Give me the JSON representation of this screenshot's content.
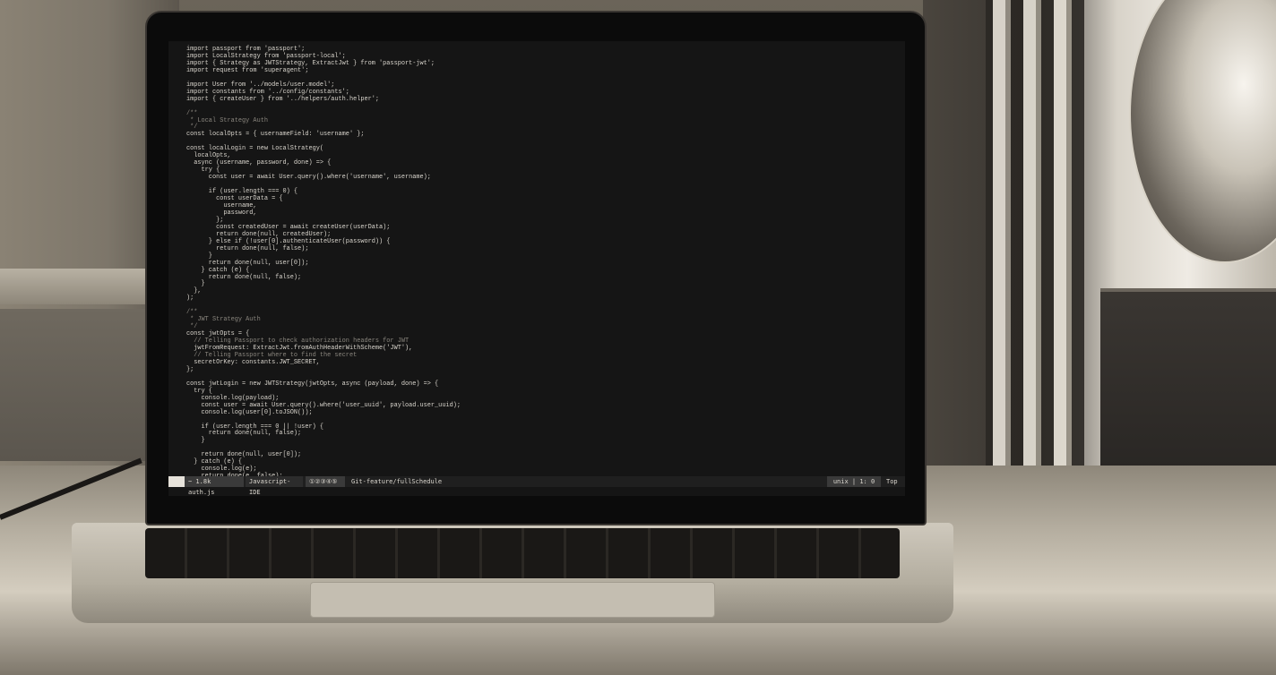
{
  "editor": {
    "code_lines": [
      "import passport from 'passport';",
      "import LocalStrategy from 'passport-local';",
      "import { Strategy as JWTStrategy, ExtractJwt } from 'passport-jwt';",
      "import request from 'superagent';",
      "",
      "import User from '../models/user.model';",
      "import constants from '../config/constants';",
      "import { createUser } from '../helpers/auth.helper';",
      "",
      "/**",
      " * Local Strategy Auth",
      " */",
      "const localOpts = { usernameField: 'username' };",
      "",
      "const localLogin = new LocalStrategy(",
      "  localOpts,",
      "  async (username, password, done) => {",
      "    try {",
      "      const user = await User.query().where('username', username);",
      "",
      "      if (user.length === 0) {",
      "        const userData = {",
      "          username,",
      "          password,",
      "        };",
      "        const createdUser = await createUser(userData);",
      "        return done(null, createdUser);",
      "      } else if (!user[0].authenticateUser(password)) {",
      "        return done(null, false);",
      "      }",
      "      return done(null, user[0]);",
      "    } catch (e) {",
      "      return done(null, false);",
      "    }",
      "  },",
      ");",
      "",
      "/**",
      " * JWT Strategy Auth",
      " */",
      "const jwtOpts = {",
      "  // Telling Passport to check authorization headers for JWT",
      "  jwtFromRequest: ExtractJwt.fromAuthHeaderWithScheme('JWT'),",
      "  // Telling Passport where to find the secret",
      "  secretOrKey: constants.JWT_SECRET,",
      "};",
      "",
      "const jwtLogin = new JWTStrategy(jwtOpts, async (payload, done) => {",
      "  try {",
      "    console.log(payload);",
      "    const user = await User.query().where('user_uuid', payload.user_uuid);",
      "    console.log(user[0].toJSON());",
      "",
      "    if (user.length === 0 || !user) {",
      "      return done(null, false);",
      "    }",
      "",
      "    return done(null, user[0]);",
      "  } catch (e) {",
      "    console.log(e);",
      "    return done(e, false);"
    ]
  },
  "statusbar": {
    "mode": "",
    "file": "~ 1.8k auth.js",
    "language": "Javascript-IDE",
    "indicators": "①②③④⑤",
    "branch": "Git-feature/fullSchedule",
    "format_pos": "unix | 1: 0",
    "scroll": "Top"
  }
}
